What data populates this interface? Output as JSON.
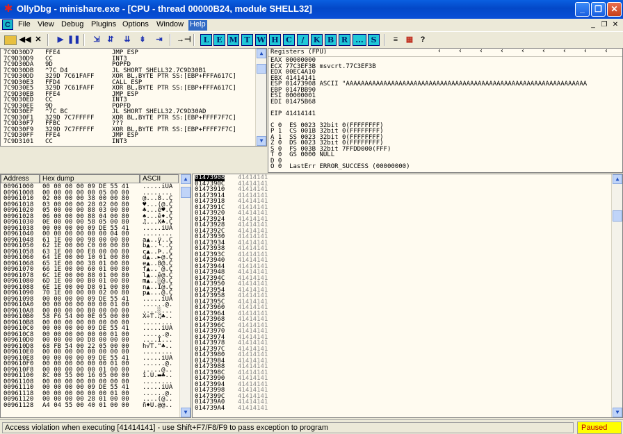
{
  "window": {
    "title": "OllyDbg - minishare.exe - [CPU - thread 00000B24, module SHELL32]",
    "min_glyph": "_",
    "max_glyph": "❐",
    "close_glyph": "✕"
  },
  "menu": {
    "app_icon_letter": "C",
    "items": [
      "File",
      "View",
      "Debug",
      "Plugins",
      "Options",
      "Window",
      "Help"
    ],
    "mdi_min": "_",
    "mdi_max": "❐",
    "mdi_close": "✕"
  },
  "toolbar": {
    "letters": [
      "L",
      "E",
      "M",
      "T",
      "W",
      "H",
      "C",
      "/",
      "K",
      "B",
      "R",
      "...",
      "S"
    ],
    "misc": [
      "≡",
      "▦",
      "?"
    ]
  },
  "cpu": {
    "rows": [
      [
        "7C9D30D7",
        "FFE4",
        "JMP ESP"
      ],
      [
        "7C9D30D9",
        "CC",
        "INT3"
      ],
      [
        "7C9D30DA",
        "9D",
        "POPFD"
      ],
      [
        "7C9D30DB",
        "^7C D4",
        "JL SHORT SHELL32.7C9D30B1"
      ],
      [
        "7C9D30DD",
        "329D 7C61FAFF",
        "XOR BL,BYTE PTR SS:[EBP+FFFA617C]"
      ],
      [
        "7C9D30E3",
        "FFD4",
        "CALL ESP"
      ],
      [
        "7C9D30E5",
        "329D 7C61FAFF",
        "XOR BL,BYTE PTR SS:[EBP+FFFA617C]"
      ],
      [
        "7C9D30EB",
        "FFE4",
        "JMP ESP"
      ],
      [
        "7C9D30ED",
        "CC",
        "INT3"
      ],
      [
        "7C9D30EE",
        "9D",
        "POPFD"
      ],
      [
        "7C9D30EF",
        "^7C BC",
        "JL SHORT SHELL32.7C9D30AD"
      ],
      [
        "7C9D30F1",
        "329D 7C7FFFFF",
        "XOR BL,BYTE PTR SS:[EBP+FFFF7F7C]"
      ],
      [
        "7C9D30F7",
        "FFBC",
        "???"
      ],
      [
        "7C9D30F9",
        "329D 7C7FFFFF",
        "XOR BL,BYTE PTR SS:[EBP+FFFF7F7C]"
      ],
      [
        "7C9D30FF",
        "FFE4",
        "JMP ESP"
      ],
      [
        "7C9D3101",
        "CC",
        "INT3"
      ]
    ]
  },
  "registers": {
    "title": "Registers (FPU)",
    "lines": [
      "EAX 00000000",
      "ECX 77C3EF3B msvcrt.77C3EF3B",
      "EDX 00EC4A10",
      "EBX 41414141",
      "ESP 01473908 ASCII \"AAAAAAAAAAAAAAAAAAAAAAAAAAAAAAAAAAAAAAAAAAAAAAAAAAAAAAAAAAAAAAAA",
      "EBP 0147BB90",
      "ESI 00000001",
      "EDI 01475B68",
      "",
      "EIP 41414141",
      "",
      "C 0  ES 0023 32bit 0(FFFFFFFF)",
      "P 1  CS 001B 32bit 0(FFFFFFFF)",
      "A 1  SS 0023 32bit 0(FFFFFFFF)",
      "Z 0  DS 0023 32bit 0(FFFFFFFF)",
      "S 0  FS 003B 32bit 7FFDD000(FFF)",
      "T 0  GS 0000 NULL",
      "D 0",
      "O 0  LastErr ERROR_SUCCESS (00000000)"
    ]
  },
  "dump": {
    "headers": [
      "Address",
      "Hex dump",
      "ASCII"
    ],
    "rows": [
      [
        "00961000",
        "00 00 00 00 09 DE 55 41",
        ".....iUA"
      ],
      [
        "00961008",
        "00 00 00 00 00 05 00 00",
        "........"
      ],
      [
        "00961010",
        "02 00 00 00 38 00 00 80",
        "@...8..Ç"
      ],
      [
        "00961018",
        "03 00 00 00 28 02 00 80",
        "♥...(@.Ç"
      ],
      [
        "00961020",
        "05 00 00 00 88 03 00 80",
        "♣...ê♥.Ç"
      ],
      [
        "00961028",
        "06 00 00 00 88 04 00 80",
        "♠...ê♦.Ç"
      ],
      [
        "00961030",
        "0E 00 00 00 58 05 00 80",
        "♫...X♣.Ç"
      ],
      [
        "00961038",
        "00 00 00 00 09 DE 55 41",
        ".....iUA"
      ],
      [
        "00961040",
        "00 00 00 00 00 00 04 00",
        "........"
      ],
      [
        "00961048",
        "61 1E 00 00 98 00 00 80",
        "a▲..ÿ..Ç"
      ],
      [
        "00961050",
        "62 1E 00 00 C0 00 00 80",
        "b▲..└..Ç"
      ],
      [
        "00961058",
        "63 1E 00 00 E8 00 00 80",
        "c▲..Þ..Ç"
      ],
      [
        "00961060",
        "64 1E 00 00 10 01 00 80",
        "d▲..►@.Ç"
      ],
      [
        "00961068",
        "65 1E 00 00 38 01 00 80",
        "e▲..8@.Ç"
      ],
      [
        "00961070",
        "66 1E 00 00 60 01 00 80",
        "f▲..`@.Ç"
      ],
      [
        "00961078",
        "6C 1E 00 00 88 01 00 80",
        "l▲..ê@.Ç"
      ],
      [
        "00961080",
        "6D 1E 00 00 B0 01 00 80",
        "m▲..░@.Ç"
      ],
      [
        "00961088",
        "6E 1E 00 00 D8 01 00 80",
        "n▲..Ï@.Ç"
      ],
      [
        "00961090",
        "70 1E 00 00 00 02 00 80",
        "p▲...@.Ç"
      ],
      [
        "00961098",
        "00 00 00 00 09 DE 55 41",
        ".....iUA"
      ],
      [
        "009610A0",
        "00 00 00 00 00 00 01 00",
        "......@."
      ],
      [
        "009610A8",
        "00 00 00 00 B0 00 00 00",
        "....░..."
      ],
      [
        "009610B0",
        "58 F6 54 00 0E 05 00 00",
        "X÷T.♫♣.."
      ],
      [
        "009610B8",
        "00 00 00 00 00 00 00 00",
        "........"
      ],
      [
        "009610C0",
        "00 00 00 00 09 DE 55 41",
        ".....iUA"
      ],
      [
        "009610C8",
        "00 00 00 00 00 00 01 00",
        "......@."
      ],
      [
        "009610D0",
        "00 00 00 00 D8 00 00 00",
        "....Ï..."
      ],
      [
        "009610D8",
        "68 FB 54 00 22 05 00 00",
        "h√T.\"♣.."
      ],
      [
        "009610E0",
        "00 00 00 00 00 00 00 00",
        "........"
      ],
      [
        "009610E8",
        "00 00 00 00 09 DE 55 41",
        ".....iUA"
      ],
      [
        "009610F0",
        "00 00 00 00 00 00 01 00",
        "......@."
      ],
      [
        "009610F8",
        "00 00 00 00 00 01 00 00",
        ".....@.."
      ],
      [
        "00961100",
        "8C 00 55 00 16 05 00 00",
        "î.U.▬♣.."
      ],
      [
        "00961108",
        "00 00 00 00 00 00 00 00",
        "........"
      ],
      [
        "00961110",
        "00 00 00 00 09 DE 55 41",
        ".....iUA"
      ],
      [
        "00961118",
        "00 00 00 00 00 00 01 00",
        "......@."
      ],
      [
        "00961120",
        "00 00 00 00 28 01 00 00",
        "....(@.."
      ],
      [
        "00961128",
        "A4 04 55 00 40 01 00 00",
        "ñ♦U.@@.."
      ]
    ]
  },
  "stack": {
    "value": "41414141",
    "addresses": [
      "01473908",
      "0147390C",
      "01473910",
      "01473914",
      "01473918",
      "0147391C",
      "01473920",
      "01473924",
      "01473928",
      "0147392C",
      "01473930",
      "01473934",
      "01473938",
      "0147393C",
      "01473940",
      "01473944",
      "01473948",
      "0147394C",
      "01473950",
      "01473954",
      "01473958",
      "0147395C",
      "01473960",
      "01473964",
      "01473968",
      "0147396C",
      "01473970",
      "01473974",
      "01473978",
      "0147397C",
      "01473980",
      "01473984",
      "01473988",
      "0147398C",
      "01473990",
      "01473994",
      "01473998",
      "0147399C",
      "014739A0",
      "014739A4"
    ]
  },
  "status": {
    "message": "Access violation when executing [41414141] - use Shift+F7/F8/F9 to pass exception to program",
    "state": "Paused"
  }
}
